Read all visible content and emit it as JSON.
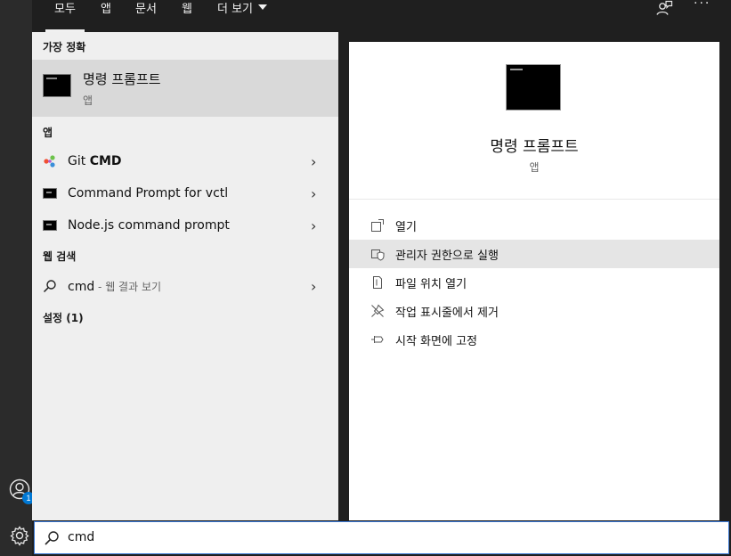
{
  "tabs": {
    "all": "모두",
    "apps": "앱",
    "documents": "문서",
    "web": "웹",
    "more": "더 보기"
  },
  "left": {
    "best_match_header": "가장 정확",
    "best_match": {
      "title": "명령 프롬프트",
      "subtitle": "앱"
    },
    "apps_header": "앱",
    "apps": [
      {
        "label_prefix": "Git ",
        "label_bold": "CMD"
      },
      {
        "label": "Command Prompt for vctl"
      },
      {
        "label": "Node.js command prompt"
      }
    ],
    "web_header": "웹 검색",
    "web_result": {
      "query": "cmd",
      "suffix": " - 웹 결과 보기"
    },
    "settings_header": "설정 (1)"
  },
  "detail": {
    "title": "명령 프롬프트",
    "subtitle": "앱",
    "actions": [
      {
        "label": "열기",
        "icon": "open-icon"
      },
      {
        "label": "관리자 권한으로 실행",
        "icon": "shield-icon"
      },
      {
        "label": "파일 위치 열기",
        "icon": "file-location-icon"
      },
      {
        "label": "작업 표시줄에서 제거",
        "icon": "unpin-icon"
      },
      {
        "label": "시작 화면에 고정",
        "icon": "pin-icon"
      }
    ]
  },
  "rail": {
    "account_badge": "1"
  },
  "search": {
    "value": "cmd"
  },
  "colors": {
    "accent": "#0078d4",
    "search_border": "#3c7ad6",
    "best_bg": "#d9d9d9",
    "hover_bg": "#e5e5e5"
  }
}
